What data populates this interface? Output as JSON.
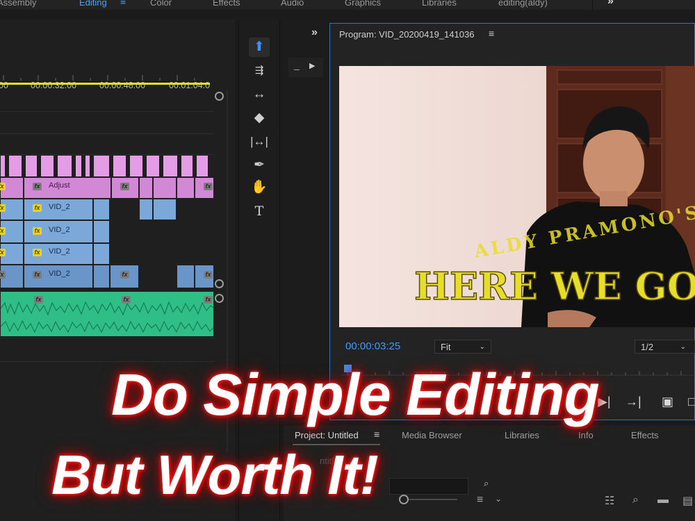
{
  "workspaces": {
    "tabs": [
      "Assembly",
      "Editing",
      "Color",
      "Effects",
      "Audio",
      "Graphics",
      "Libraries",
      "editing(aldy)"
    ],
    "active": "Editing",
    "menu_icon": "hamburger-icon",
    "overflow_icon": "double-chevron-right-icon"
  },
  "timeline": {
    "ruler_labels": [
      "00",
      "00:00:32:00",
      "00:00:48:00",
      "00:01:04:0"
    ],
    "work_area_color": "#e2e31b",
    "clip_labels": {
      "adjust": "Adjust",
      "vid": "VID_2"
    },
    "fx_badge": "fx",
    "colors": {
      "adjustment": "#e59ce6",
      "video": "#7ba7d9",
      "audio": "#2fbf86"
    }
  },
  "tools": {
    "items": [
      "selection-tool-icon",
      "track-select-icon",
      "ripple-edit-icon",
      "razor-icon",
      "slip-icon",
      "pen-icon",
      "hand-icon",
      "type-icon"
    ],
    "active": "selection-tool-icon"
  },
  "program": {
    "title": "Program: VID_20200419_141036",
    "menu_icon": "hamburger-icon",
    "video_text": {
      "line1": "ALDY  PRAMONO'S",
      "line2": "HERE WE GO AGA"
    },
    "timecode": "00:00:03:25",
    "zoom": "Fit",
    "resolution": "1/2",
    "accent": "#3b8fff"
  },
  "project_panel": {
    "tabs": [
      "Project: Untitled",
      "Media Browser",
      "Libraries",
      "Info",
      "Effects"
    ],
    "active": "Project: Untitled",
    "faint_text": "ntitle"
  },
  "overlay": {
    "line1": "Do Simple Editing",
    "line2": "But Worth It!"
  }
}
